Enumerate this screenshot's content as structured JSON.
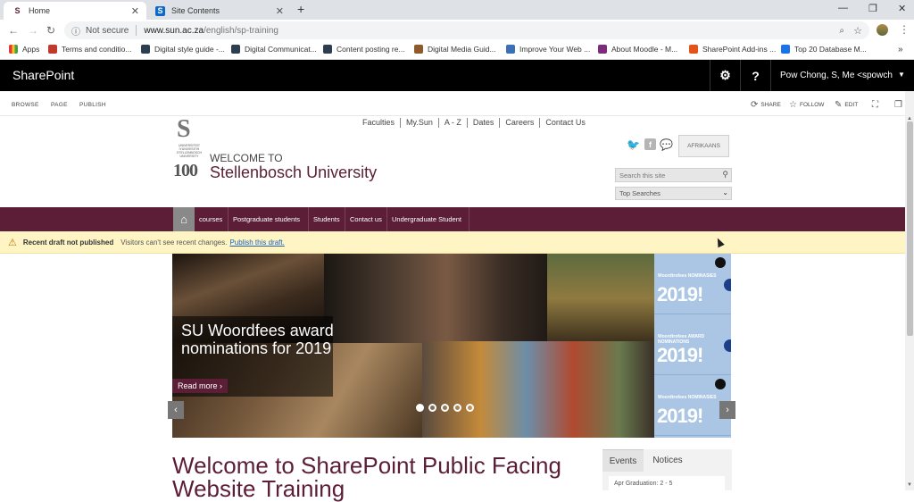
{
  "browser": {
    "tabs": [
      {
        "title": "Home",
        "active": true
      },
      {
        "title": "Site Contents",
        "active": false
      }
    ],
    "new_tab_symbol": "+",
    "address": {
      "security": "Not secure",
      "host": "www.sun.ac.za",
      "path": "/english/sp-training"
    },
    "bookmarks": [
      {
        "label": "Apps",
        "color": "#e53935"
      },
      {
        "label": "Terms and conditio...",
        "color": "#c0392b"
      },
      {
        "label": "Digital style guide -...",
        "color": "#2c3e50"
      },
      {
        "label": "Digital Communicat...",
        "color": "#2c3e50"
      },
      {
        "label": "Content posting re...",
        "color": "#2c3e50"
      },
      {
        "label": "Digital Media Guid...",
        "color": "#8e5a2b"
      },
      {
        "label": "Improve Your Web ...",
        "color": "#3b6fb6"
      },
      {
        "label": "About Moodle - M...",
        "color": "#7b2d7b"
      },
      {
        "label": "SharePoint Add-ins ...",
        "color": "#e5531a"
      },
      {
        "label": "Top 20 Database M...",
        "color": "#1a73e8"
      }
    ]
  },
  "suitebar": {
    "brand": "SharePoint",
    "settings_icon": "gear-icon",
    "help_label": "?",
    "user": "Pow Chong, S, Me <spowch"
  },
  "ribbon": {
    "tabs": [
      "BROWSE",
      "PAGE",
      "PUBLISH"
    ],
    "actions": [
      "SHARE",
      "FOLLOW",
      "EDIT"
    ]
  },
  "site": {
    "logo_lines": [
      "UNIVERSITEIT",
      "iYUNIVESITHI",
      "STELLENBOSCH",
      "UNIVERSITY"
    ],
    "logo_hundred": "100",
    "welcome_small": "WELCOME TO",
    "welcome_big": "Stellenbosch University",
    "top_links": [
      "Faculties",
      "My.Sun",
      "A - Z",
      "Dates",
      "Careers",
      "Contact Us"
    ],
    "afrikaans_label": "AFRIKAANS",
    "search_placeholder": "Search this site",
    "top_searches_label": "Top Searches"
  },
  "nav": {
    "items": [
      "courses",
      "Postgraduate students",
      "Students",
      "Contact us",
      "Undergraduate Student"
    ]
  },
  "status": {
    "title": "Recent draft not published",
    "message": "Visitors can't see recent changes.",
    "link": "Publish this draft."
  },
  "carousel": {
    "caption": "SU Woordfees award nominations for 2019",
    "read_more": "Read more ›",
    "slide_count": 5,
    "active_slide": 0,
    "poster_title": "Woordtrofees AWARD NOMINATIONS",
    "poster_title_alt": "Woordtrofees NOMINASIES",
    "poster_year": "2019!",
    "prev": "‹",
    "next": "›"
  },
  "page": {
    "title_line1": "Welcome to SharePoint Public Facing",
    "title_line2": "Website Training",
    "tabs": [
      "Events",
      "Notices"
    ],
    "event_peek": "Apr    Graduation: 2 - 5"
  }
}
